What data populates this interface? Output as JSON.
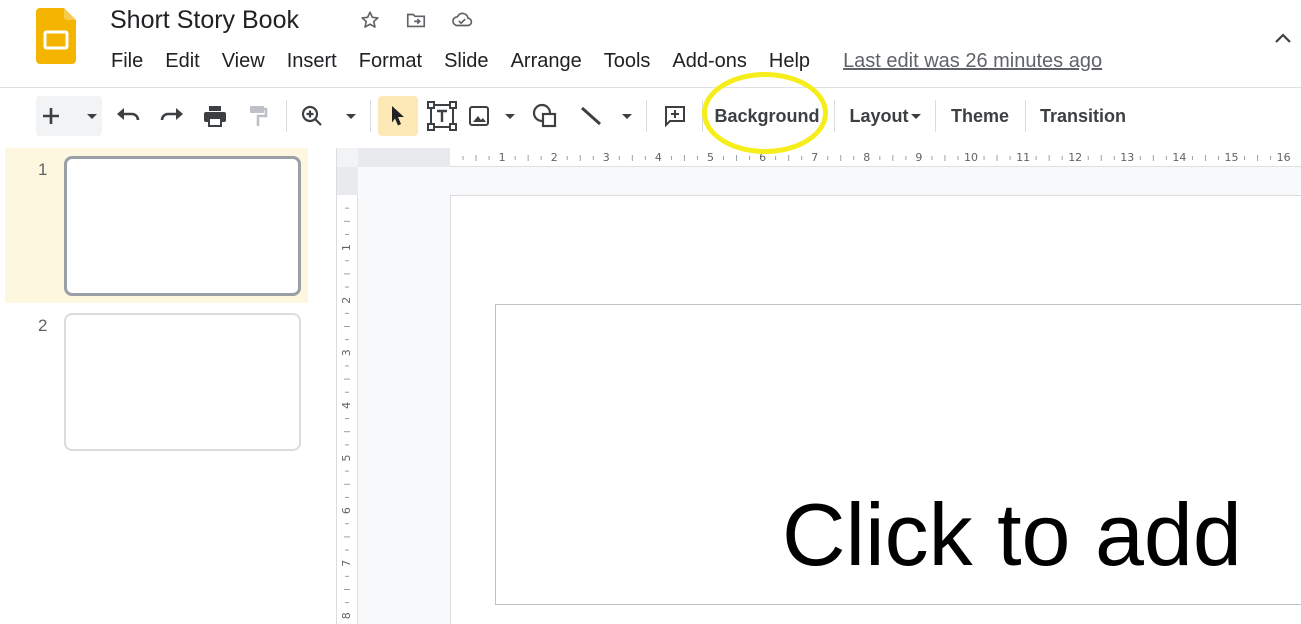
{
  "document": {
    "title": "Short Story Book"
  },
  "menu": {
    "items": [
      "File",
      "Edit",
      "View",
      "Insert",
      "Format",
      "Slide",
      "Arrange",
      "Tools",
      "Add-ons",
      "Help"
    ],
    "last_edit": "Last edit was 26 minutes ago"
  },
  "toolbar": {
    "background_label": "Background",
    "layout_label": "Layout",
    "theme_label": "Theme",
    "transition_label": "Transition",
    "highlighted_button": "Background",
    "highlight_color": "#f6ee1a"
  },
  "filmstrip": {
    "slides": [
      {
        "number": "1",
        "selected": true
      },
      {
        "number": "2",
        "selected": false
      }
    ]
  },
  "rulers": {
    "horizontal": [
      "1",
      "2",
      "3",
      "4",
      "5",
      "6",
      "7",
      "8",
      "9",
      "10",
      "11",
      "12",
      "13",
      "14",
      "15",
      "16"
    ],
    "vertical": [
      "1",
      "2",
      "3",
      "4",
      "5",
      "6",
      "7",
      "8"
    ]
  },
  "slide": {
    "title_placeholder": "Click to add"
  },
  "colors": {
    "app_yellow": "#f4b400",
    "selected_slide_bg": "#fef7e0"
  }
}
